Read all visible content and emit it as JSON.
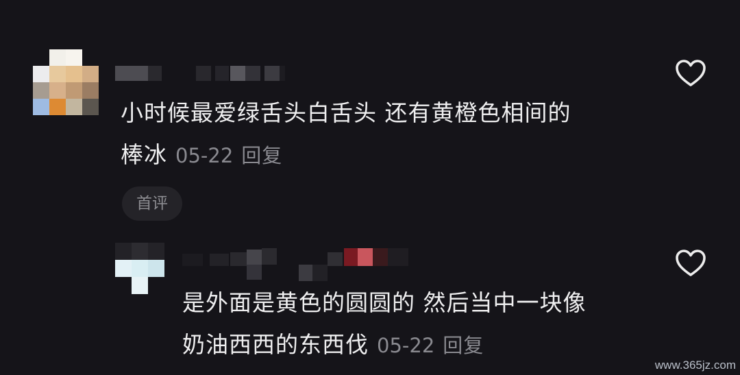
{
  "comments": [
    {
      "text": "小时候最爱绿舌头白舌头 还有黄橙色相间的棒冰",
      "line1": "小时候最爱绿舌头白舌头 还有黄橙色相间的",
      "line2": "棒冰",
      "date": "05-22",
      "reply_label": "回复",
      "tag": "首评"
    },
    {
      "text": "是外面是黄色的圆圆的 然后当中一块像奶油西西的东西伐",
      "line1": "是外面是黄色的圆圆的 然后当中一块像",
      "line2": "奶油西西的东西伐",
      "date": "05-22",
      "reply_label": "回复"
    }
  ],
  "icons": {
    "like": "heart-outline-icon"
  },
  "watermark": "www.365jz.com",
  "colors": {
    "background": "#151419",
    "text": "#efeff0",
    "meta": "#8a8a90",
    "tag_bg": "#242328"
  }
}
